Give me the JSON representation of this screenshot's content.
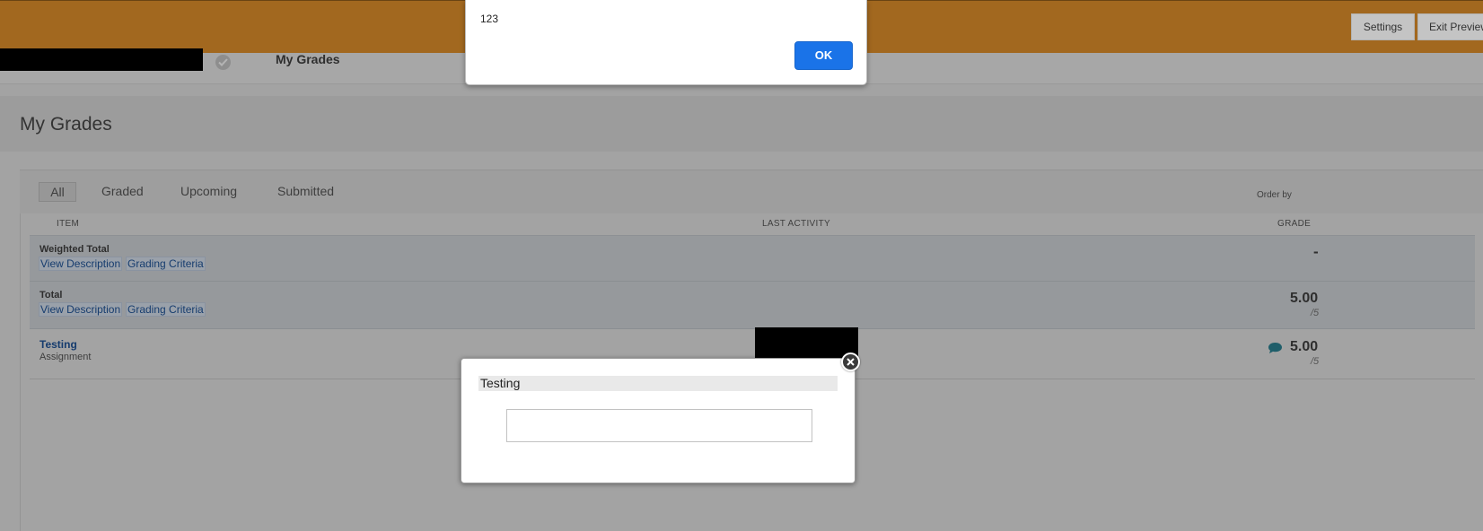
{
  "header": {
    "settings_label": "Settings",
    "exit_preview_label": "Exit Preview",
    "brand_color": "#a2681f"
  },
  "nav": {
    "title": "My Grades"
  },
  "page": {
    "title": "My Grades"
  },
  "filters": {
    "tabs": [
      "All",
      "Graded",
      "Upcoming",
      "Submitted"
    ],
    "active": "All",
    "order_by_label": "Order by"
  },
  "table": {
    "columns": [
      "ITEM",
      "LAST ACTIVITY",
      "GRADE"
    ],
    "rows": [
      {
        "name": "Weighted Total",
        "links": [
          "View Description",
          "Grading Criteria"
        ],
        "grade": "-"
      },
      {
        "name": "Total",
        "links": [
          "View Description",
          "Grading Criteria"
        ],
        "grade": "5.00",
        "max": "/5"
      },
      {
        "name": "Testing",
        "type": "Assignment",
        "grade": "5.00",
        "max": "/5",
        "icon": "comment-icon"
      }
    ]
  },
  "alert": {
    "message": "123",
    "ok_label": "OK",
    "ok_color": "#1a73e8"
  },
  "modal": {
    "title": "Testing",
    "input_value": ""
  }
}
